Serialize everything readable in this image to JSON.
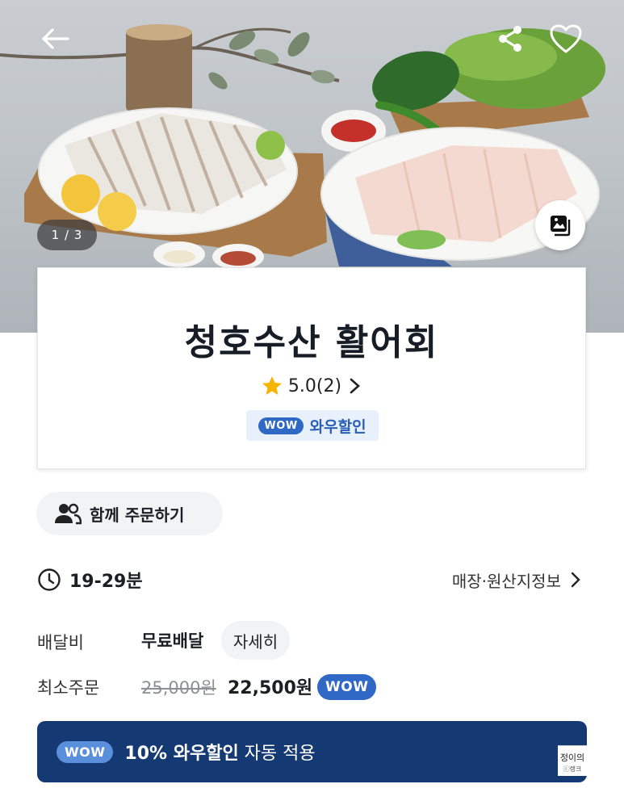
{
  "hero": {
    "image_counter": "1 / 3",
    "icons": [
      "back-arrow-icon",
      "share-icon",
      "heart-icon",
      "gallery-icon"
    ]
  },
  "store": {
    "name": "청호수산 활어회",
    "rating": "5.0(2)",
    "wow_pill": "WOW",
    "wow_discount_label": "와우할인"
  },
  "group_order": {
    "label": "함께 주문하기"
  },
  "delivery": {
    "time": "19-29분",
    "store_info_link": "매장·원산지정보"
  },
  "fees": {
    "delivery_fee_label": "배달비",
    "delivery_fee_value": "무료배달",
    "detail_button": "자세히",
    "min_order_label": "최소주문",
    "min_order_original": "25,000원",
    "min_order_discounted": "22,500원",
    "min_order_wow": "WOW"
  },
  "banner": {
    "wow_pill": "WOW",
    "text_strong": "10% 와우할인",
    "text_rest": " 자동 적용",
    "ad_tag": "정이의",
    "ad_tag_sub": "ⓒ랭크"
  },
  "colors": {
    "accent_blue": "#2f68c5",
    "banner_navy": "#153a73",
    "star_yellow": "#f5b400"
  }
}
